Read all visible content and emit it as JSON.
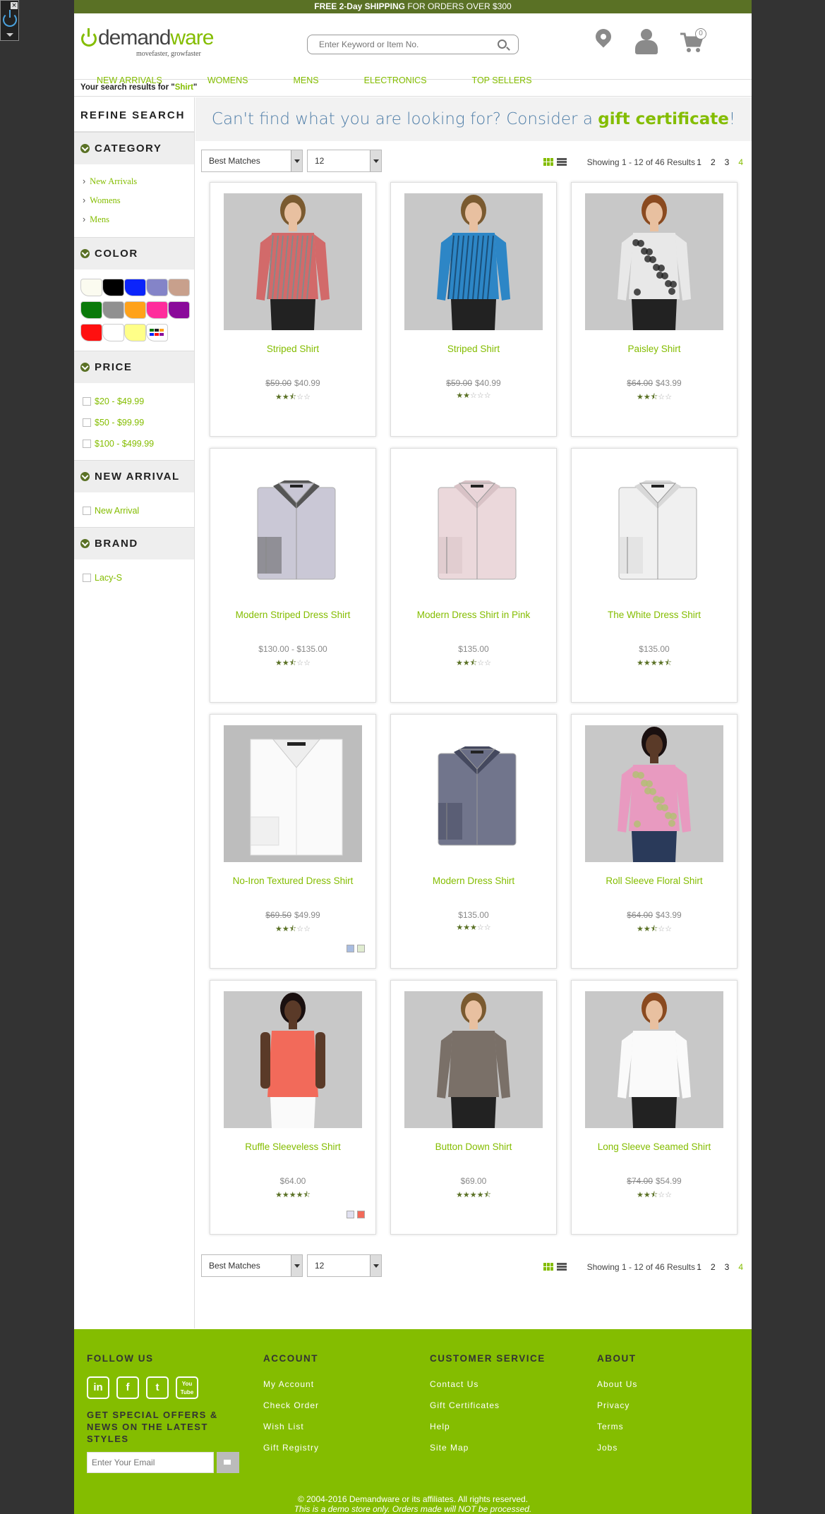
{
  "promo": {
    "bold": "FREE 2-Day SHIPPING",
    "rest": " FOR ORDERS OVER $300"
  },
  "header": {
    "logo_main": "demand",
    "logo_accent": "ware",
    "logo_tagline": "movefaster, growfaster",
    "search_placeholder": "Enter Keyword or Item No.",
    "cart_count": "0"
  },
  "nav": [
    "NEW ARRIVALS",
    "WOMENS",
    "MENS",
    "ELECTRONICS",
    "TOP SELLERS"
  ],
  "breadcrumb": {
    "prefix": "Your search results for \"",
    "query": "Shirt",
    "suffix": "\""
  },
  "refine": {
    "title": "REFINE SEARCH",
    "category": {
      "title": "CATEGORY",
      "items": [
        "New Arrivals",
        "Womens",
        "Mens"
      ]
    },
    "color": {
      "title": "COLOR",
      "swatches": [
        "#fbfbf0",
        "#000000",
        "#0b24fb",
        "#8484c8",
        "#c8a08c",
        "#0a7a0a",
        "#909090",
        "#ffa21a",
        "#ff2c9c",
        "#8a0a9a",
        "#ff1010",
        "#ffffff",
        "#ffff88",
        "multi"
      ]
    },
    "price": {
      "title": "PRICE",
      "items": [
        "$20 - $49.99",
        "$50 - $99.99",
        "$100 - $499.99"
      ]
    },
    "new_arrival": {
      "title": "NEW ARRIVAL",
      "items": [
        "New Arrival"
      ]
    },
    "brand": {
      "title": "BRAND",
      "items": [
        "Lacy-S"
      ]
    }
  },
  "banner": {
    "text": "Can't find what you are looking for? Consider a ",
    "link": "gift certificate",
    "end": "!"
  },
  "sorting": {
    "sort_value": "Best Matches",
    "page_size": "12",
    "showing": "Showing 1 - 12 of 46 Results",
    "pages": [
      "1",
      "2",
      "3",
      "4"
    ]
  },
  "products": [
    {
      "name": "Striped Shirt",
      "old": "$59.00",
      "price": "$40.99",
      "rating": 2.5,
      "img": "woman",
      "shirt": "#d26a6a",
      "stripe": "#888"
    },
    {
      "name": "Striped Shirt",
      "old": "$59.00",
      "price": "$40.99",
      "rating": 2,
      "img": "woman",
      "shirt": "#2d86c6",
      "stripe": "#1a4f7a"
    },
    {
      "name": "Paisley Shirt",
      "old": "$64.00",
      "price": "$43.99",
      "rating": 2.5,
      "img": "woman",
      "shirt": "#e8e8e8",
      "stripe": "#222"
    },
    {
      "name": "Modern Striped Dress Shirt",
      "old": "",
      "price": "$130.00 - $135.00",
      "rating": 2.5,
      "img": "folded",
      "shirt": "#c8c6d4",
      "stripe": "#555"
    },
    {
      "name": "Modern Dress Shirt in Pink",
      "old": "",
      "price": "$135.00",
      "rating": 2.5,
      "img": "folded",
      "shirt": "#ead6da",
      "stripe": "#d8c2c6"
    },
    {
      "name": "The White Dress Shirt",
      "old": "",
      "price": "$135.00",
      "rating": 4.5,
      "img": "folded",
      "shirt": "#f0f0f0",
      "stripe": "#d8d8d8"
    },
    {
      "name": "No-Iron Textured Dress Shirt",
      "old": "$69.50",
      "price": "$49.99",
      "rating": 2.5,
      "img": "folded-big",
      "shirt": "#f4f4f4",
      "stripe": "#ddd",
      "swatches": [
        "#a8bce0",
        "#e0ecd0"
      ]
    },
    {
      "name": "Modern Dress Shirt",
      "old": "",
      "price": "$135.00",
      "rating": 3,
      "img": "folded",
      "shirt": "#6a6e86",
      "stripe": "#44485e"
    },
    {
      "name": "Roll Sleeve Floral Shirt",
      "old": "$64.00",
      "price": "$43.99",
      "rating": 2.5,
      "img": "woman-dark",
      "shirt": "#e89ac0",
      "stripe": "#b0c070"
    },
    {
      "name": "Ruffle Sleeveless Shirt",
      "old": "",
      "price": "$64.00",
      "rating": 4.5,
      "img": "woman-dark",
      "shirt": "#f26a5a",
      "stripe": "#f58a7a",
      "swatches": [
        "#e0e0f0",
        "#f26a5a"
      ]
    },
    {
      "name": "Button Down Shirt",
      "old": "",
      "price": "$69.00",
      "rating": 4.5,
      "img": "woman",
      "shirt": "#7a7068",
      "stripe": "#5e5650"
    },
    {
      "name": "Long Sleeve Seamed Shirt",
      "old": "$74.00",
      "price": "$54.99",
      "rating": 2.5,
      "img": "woman",
      "shirt": "#fafafa",
      "stripe": "#ddd"
    }
  ],
  "footer": {
    "follow": "FOLLOW US",
    "social": [
      "in",
      "f",
      "t",
      "You Tube"
    ],
    "offers": "GET SPECIAL OFFERS & NEWS ON THE LATEST STYLES",
    "email_placeholder": "Enter Your Email",
    "columns": [
      {
        "title": "ACCOUNT",
        "links": [
          "My Account",
          "Check Order",
          "Wish List",
          "Gift Registry"
        ]
      },
      {
        "title": "CUSTOMER SERVICE",
        "links": [
          "Contact Us",
          "Gift Certificates",
          "Help",
          "Site Map"
        ]
      },
      {
        "title": "ABOUT",
        "links": [
          "About Us",
          "Privacy",
          "Terms",
          "Jobs"
        ]
      }
    ],
    "copyright": "© 2004-2016 Demandware or its affiliates. All rights reserved.",
    "demo_note": "This is a demo store only. Orders made will NOT be processed."
  }
}
